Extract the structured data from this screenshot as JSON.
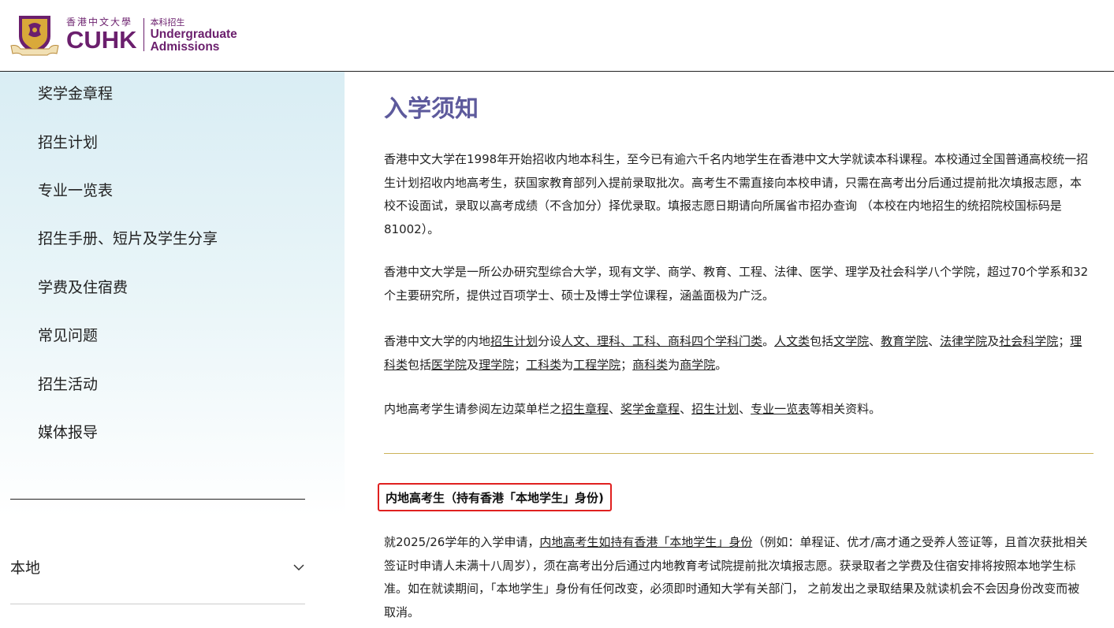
{
  "header": {
    "cn_name": "香港中文大學",
    "brand": "CUHK",
    "ug_cn": "本科招生",
    "ug_line1": "Undergraduate",
    "ug_line2": "Admissions"
  },
  "sidebar": {
    "items": [
      {
        "label": "奖学金章程"
      },
      {
        "label": "招生计划"
      },
      {
        "label": "专业一览表"
      },
      {
        "label": "招生手册、短片及学生分享"
      },
      {
        "label": "学费及住宿费"
      },
      {
        "label": "常见问题"
      },
      {
        "label": "招生活动"
      },
      {
        "label": "媒体报导"
      }
    ],
    "region_label": "本地"
  },
  "main": {
    "title": "入学须知",
    "p1": "香港中文大学在1998年开始招收内地本科生，至今已有逾六千名内地学生在香港中文大学就读本科课程。本校通过全国普通高校统一招生计划招收内地高考生，获国家教育部列入提前录取批次。高考生不需直接向本校申请，只需在高考出分后通过提前批次填报志愿，本校不设面试，录取以高考成绩（不含加分）择优录取。填报志愿日期请向所属省市招办查询 （本校在内地招生的统招院校国标码是81002）。",
    "p2": "香港中文大学是一所公办研究型综合大学，现有文学、商学、教育、工程、法律、医学、理学及社会科学八个学院，超过70个学系和32个主要研究所，提供过百项学士、硕士及博士学位课程，涵盖面极为广泛。",
    "p3": {
      "t1": "香港中文大学的内地",
      "l1": "招生计划",
      "t2": "分设",
      "l2": "人文、理科、工科、商科四个学科门类",
      "t3": "。",
      "l3": "人文类",
      "t4": "包括",
      "l4": "文学院",
      "t5": "、",
      "l5": "教育学院",
      "t6": "、",
      "l6": "法律学院",
      "t7": "及",
      "l7": "社会科学院",
      "t8": "；",
      "l8": "理科类",
      "t9": "包括",
      "l9": "医学院",
      "t10": "及",
      "l10": "理学院",
      "t11": "；",
      "l11": "工科类",
      "t12": "为",
      "l12": "工程学院",
      "t13": "；",
      "l13": "商科类",
      "t14": "为",
      "l14": "商学院",
      "t15": "。"
    },
    "p4": {
      "t1": "内地高考学生请参阅左边菜单栏之",
      "l1": "招生章程",
      "t2": "、",
      "l2": "奖学金章程",
      "t3": "、",
      "l3": "招生计划",
      "t4": "、",
      "l4": "专业一览表",
      "t5": "等相关资料。"
    },
    "subheading": "内地高考生（持有香港「本地学生」身份)",
    "p5": {
      "t1": "就2025/26学年的入学申请，",
      "l1": "内地高考生如持有香港「本地学生」身份",
      "t2": "（例如：单程证、优才/高才通之受养人签证等，且首次获批相关签证时申请人未满十八周岁），须在高考出分后通过内地教育考试院提前批次填报志愿。获录取者之学费及住宿安排将按照本地学生标准。如在就读期间，「本地学生」身份有任何改变，必须即时通知大学有关部门， 之前发出之录取结果及就读机会不会因身份改变而被取消。"
    }
  }
}
